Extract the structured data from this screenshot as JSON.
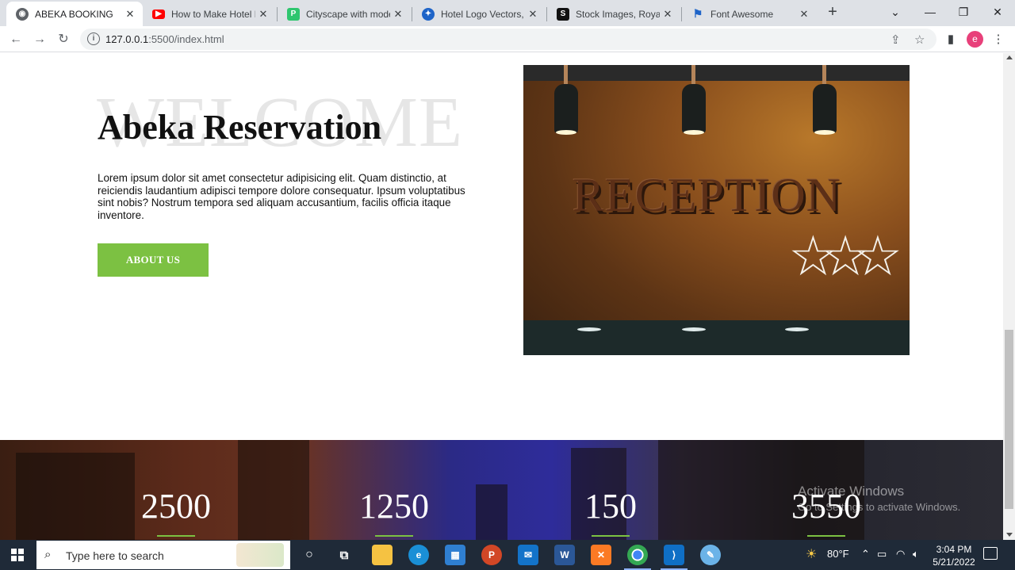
{
  "browser": {
    "tabs": [
      {
        "title": "ABEKA BOOKING",
        "icon": "globe-icon",
        "active": true
      },
      {
        "title": "How to Make Hotel Bo",
        "icon": "youtube-icon",
        "active": false
      },
      {
        "title": "Cityscape with moder",
        "icon": "pixabay-icon",
        "active": false
      },
      {
        "title": "Hotel Logo Vectors, Pl",
        "icon": "bird-icon",
        "active": false
      },
      {
        "title": "Stock Images, Royalty",
        "icon": "shutterstock-icon",
        "active": false
      },
      {
        "title": "Font Awesome",
        "icon": "flag-icon",
        "active": false
      }
    ],
    "close_glyph": "✕",
    "new_tab_glyph": "+",
    "url_host": "127.0.0.1",
    "url_path": ":5500/index.html",
    "profile_initial": "e"
  },
  "page": {
    "background_word": "WELCOME",
    "heading": "Abeka Reservation",
    "paragraph": "Lorem ipsum dolor sit amet consectetur adipisicing elit. Quam distinctio, at reiciendis laudantium adipisci tempore dolore consequatur. Ipsum voluptatibus sint nobis? Nostrum tempora sed aliquam accusantium, facilis officia itaque inventore.",
    "about_button": "ABOUT US",
    "reception_sign": "RECEPTION",
    "accent_color": "#7cc142",
    "stats": [
      "2500",
      "1250",
      "150",
      "3550"
    ]
  },
  "watermark": {
    "title": "Activate Windows",
    "subtitle": "Go to Settings to activate Windows."
  },
  "taskbar": {
    "search_placeholder": "Type here to search",
    "weather": "80°F",
    "time": "3:04 PM",
    "date": "5/21/2022"
  }
}
